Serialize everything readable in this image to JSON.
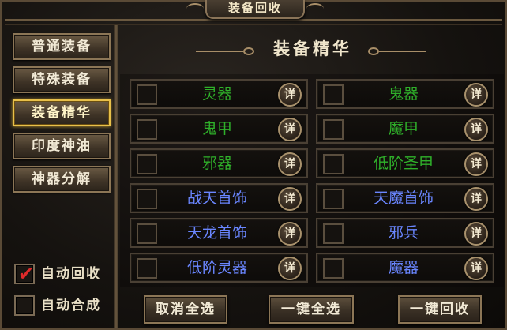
{
  "window": {
    "title": "装备回收"
  },
  "sidebar": {
    "items": [
      {
        "label": "普通装备",
        "active": false
      },
      {
        "label": "特殊装备",
        "active": false
      },
      {
        "label": "装备精华",
        "active": true
      },
      {
        "label": "印度神油",
        "active": false
      },
      {
        "label": "神器分解",
        "active": false
      }
    ],
    "auto_recycle": {
      "label": "自动回收",
      "checked": true
    },
    "auto_synthesize": {
      "label": "自动合成",
      "checked": false
    }
  },
  "main": {
    "title": "装备精华",
    "detail_label": "详",
    "items": [
      {
        "name": "灵器",
        "color": "#2fb02a",
        "checked": false
      },
      {
        "name": "鬼器",
        "color": "#2fb02a",
        "checked": false
      },
      {
        "name": "鬼甲",
        "color": "#2fb02a",
        "checked": false
      },
      {
        "name": "魔甲",
        "color": "#2fb02a",
        "checked": false
      },
      {
        "name": "邪器",
        "color": "#2fb02a",
        "checked": false
      },
      {
        "name": "低阶圣甲",
        "color": "#2fb02a",
        "checked": false
      },
      {
        "name": "战天首饰",
        "color": "#6a86ff",
        "checked": false
      },
      {
        "name": "天魔首饰",
        "color": "#6a86ff",
        "checked": false
      },
      {
        "name": "天龙首饰",
        "color": "#6a86ff",
        "checked": false
      },
      {
        "name": "邪兵",
        "color": "#6a86ff",
        "checked": false
      },
      {
        "name": "低阶灵器",
        "color": "#6a86ff",
        "checked": false
      },
      {
        "name": "魔器",
        "color": "#6a86ff",
        "checked": false
      }
    ]
  },
  "actions": {
    "deselect_all": "取消全选",
    "select_all": "一键全选",
    "recycle_all": "一键回收"
  }
}
